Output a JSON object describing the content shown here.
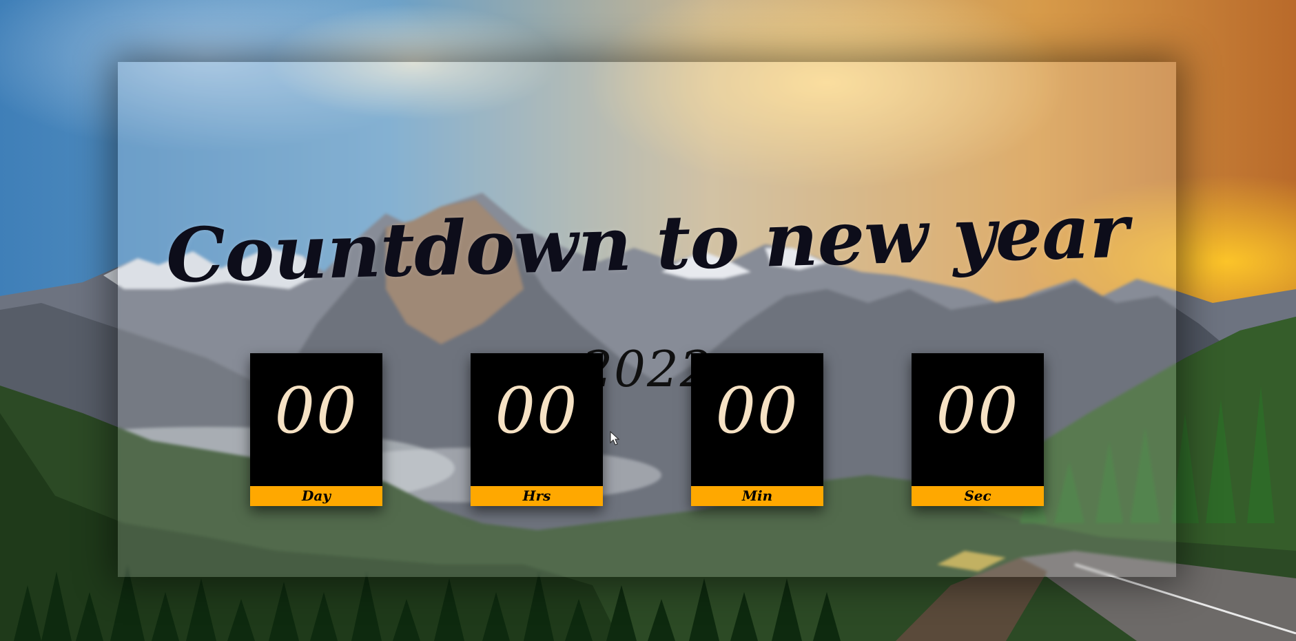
{
  "page": {
    "title": "Countdown to new year",
    "year": "-2022-"
  },
  "countdown": [
    {
      "value": "00",
      "label": "Day"
    },
    {
      "value": "00",
      "label": "Hrs"
    },
    {
      "value": "00",
      "label": "Min"
    },
    {
      "value": "00",
      "label": "Sec"
    }
  ],
  "colors": {
    "label_bar": "#ffa800",
    "box_bg": "#000000",
    "digits": "#f6e2c4",
    "title": "#0d0d1a"
  },
  "icons": {
    "cursor": "mouse-pointer-icon"
  }
}
